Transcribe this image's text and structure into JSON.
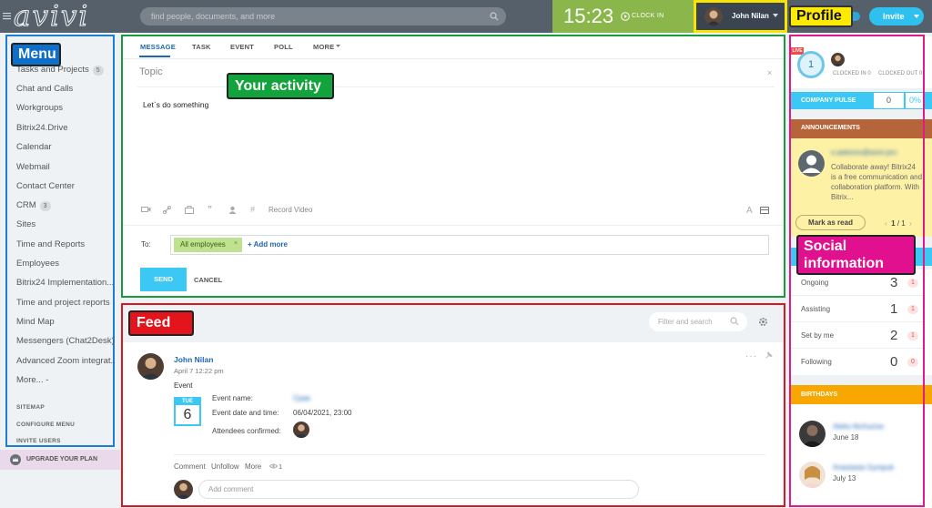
{
  "topbar": {
    "logo": "avivi",
    "search_placeholder": "find people, documents, and more",
    "clock_time": "15:23",
    "clock_in": "CLOCK IN",
    "user_name": "John Nilan",
    "invite": "Invite",
    "profile_label": "Profile"
  },
  "menu": {
    "label": "Menu",
    "items": [
      {
        "label": "Tasks and Projects",
        "badge": "5"
      },
      {
        "label": "Chat and Calls"
      },
      {
        "label": "Workgroups"
      },
      {
        "label": "Bitrix24.Drive"
      },
      {
        "label": "Calendar"
      },
      {
        "label": "Webmail"
      },
      {
        "label": "Contact Center"
      },
      {
        "label": "CRM",
        "badge": "3"
      },
      {
        "label": "Sites"
      },
      {
        "label": "Time and Reports"
      },
      {
        "label": "Employees"
      },
      {
        "label": "Bitrix24 Implementation..."
      },
      {
        "label": "Time and project reports"
      },
      {
        "label": "Mind Map"
      },
      {
        "label": "Messengers (Chat2Desk)"
      },
      {
        "label": "Advanced Zoom integrat..."
      },
      {
        "label": "More... -"
      }
    ],
    "sitemap": "SITEMAP",
    "configure": "CONFIGURE MENU",
    "invite_users": "INVITE USERS",
    "upgrade": "UPGRADE YOUR PLAN"
  },
  "composer": {
    "label": "Your activity",
    "tabs": [
      "MESSAGE",
      "TASK",
      "EVENT",
      "POLL",
      "MORE"
    ],
    "topic_placeholder": "Topic",
    "close": "×",
    "message": "Let`s do something",
    "record_video": "Record Video",
    "font_icon": "A",
    "to_label": "To:",
    "recipient": "All employees",
    "chip_remove": "×",
    "add_more": "+ Add more",
    "send": "SEND",
    "cancel": "CANCEL"
  },
  "feed": {
    "label": "Feed",
    "filter_placeholder": "Filter and search",
    "post": {
      "author": "John Nilan",
      "time": "April 7 12:22 pm",
      "type": "Event",
      "cal_day": "TUE",
      "cal_num": "6",
      "event_name_label": "Event name:",
      "event_name_value": "Cpae",
      "event_date_label": "Event date and time:",
      "event_date_value": "06/04/2021, 23:00",
      "attendees_label": "Attendees confirmed:",
      "dots": "···",
      "actions": [
        "Comment",
        "Unfollow",
        "More"
      ],
      "views": "1",
      "comment_placeholder": "Add comment"
    }
  },
  "right": {
    "social_label": "Social information",
    "live": "LIVE",
    "timer": "1",
    "clocked_in": "CLOCKED IN 0",
    "clocked_out": "CLOCKED OUT 0",
    "pulse_label": "COMPANY PULSE",
    "pulse_a": "0",
    "pulse_b": "0%",
    "announcements_title": "ANNOUNCEMENTS",
    "announcement_email": "s.askerov@avivi.pro",
    "announcement_text": "Collaborate away! Bitrix24\nis a free communication and\ncollaboration platform. With\nBitrix...",
    "mark_read": "Mark as read",
    "pager_prev": "‹",
    "pager_cur": "1",
    "pager_total": "/ 1",
    "pager_next": "›",
    "tasks": [
      {
        "label": "Ongoing",
        "count": "3",
        "badge": "1"
      },
      {
        "label": "Assisting",
        "count": "1",
        "badge": "1"
      },
      {
        "label": "Set by me",
        "count": "2",
        "badge": "1"
      },
      {
        "label": "Following",
        "count": "0",
        "badge": "0"
      }
    ],
    "birthdays_title": "BIRTHDAYS",
    "birthdays": [
      {
        "name": "Aleks Atchuzow",
        "date": "June 18"
      },
      {
        "name": "Anastasia Gympuk",
        "date": "July 13"
      }
    ]
  },
  "colors": {
    "topbar": "#55606b",
    "accent": "#3bc8f5",
    "clock": "#8bb64b",
    "menu_frame": "#1d7dd0",
    "activity_frame": "#1a9a3a",
    "feed_frame": "#d71a20",
    "social_frame": "#e01a8c",
    "profile_frame": "#f8e400"
  },
  "icons": [
    "hamburger-icon",
    "search-icon",
    "play-icon",
    "chevron-down-icon",
    "video-icon",
    "link-icon",
    "mention-icon",
    "quote-icon",
    "person-icon",
    "hashtag-icon",
    "panel-icon",
    "gear-icon",
    "eye-icon",
    "pin-icon",
    "crown-icon"
  ]
}
